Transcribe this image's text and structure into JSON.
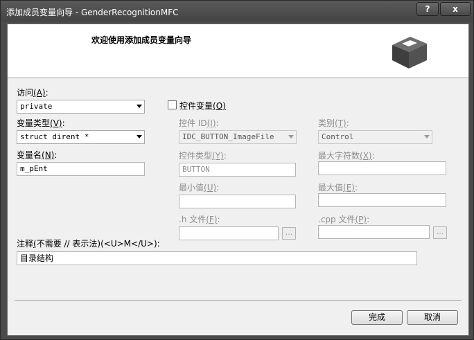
{
  "window": {
    "title": "添加成员变量向导 - GenderRecognitionMFC",
    "help_label": "?",
    "close_label": "x"
  },
  "header": {
    "title": "欢迎使用添加成员变量向导"
  },
  "form": {
    "access_label": "访问",
    "access_key": "(A)",
    "access_colon": ":",
    "access_value": "private",
    "var_type_label": "变量类型",
    "var_type_key": "(V)",
    "var_type_colon": ":",
    "var_type_value": "struct dirent *",
    "var_name_label": "变量名",
    "var_name_key": "(N)",
    "var_name_colon": ":",
    "var_name_value": "m_pEnt",
    "control_var_label": "控件变量",
    "control_var_key": "(O)",
    "control_var_checked": false,
    "control_id_label": "控件 ID",
    "control_id_key": "(I)",
    "control_id_colon": ":",
    "control_id_value": "IDC_BUTTON_ImageFile",
    "category_label": "类别",
    "category_key": "(T)",
    "category_colon": ":",
    "category_value": "Control",
    "control_type_label": "控件类型",
    "control_type_key": "(Y)",
    "control_type_colon": ":",
    "control_type_value": "BUTTON",
    "max_chars_label": "最大字符数",
    "max_chars_key": "(X)",
    "max_chars_colon": ":",
    "min_value_label": "最小值",
    "min_value_key": "(U)",
    "min_value_colon": ":",
    "max_value_label": "最大值",
    "max_value_key": "(E)",
    "max_value_colon": ":",
    "h_file_label": ".h 文件",
    "h_file_key": "(F)",
    "h_file_colon": ":",
    "cpp_file_label": ".cpp 文件",
    "cpp_file_key": "(P)",
    "cpp_file_colon": ":",
    "browse_label": "...",
    "comment_label_prefix": "注释",
    "comment_key": "(",
    "comment_label_suffix": "不需要 // 表示法)(<U>M</U>):",
    "comment_value": "目录结构"
  },
  "buttons": {
    "finish": "完成",
    "cancel": "取消"
  }
}
